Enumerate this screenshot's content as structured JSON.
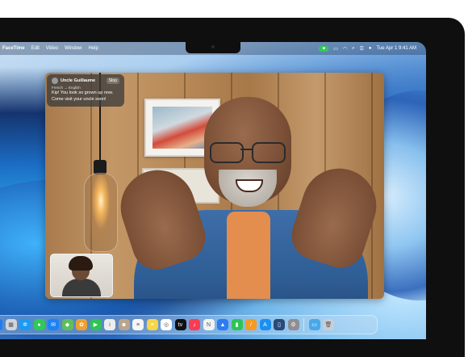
{
  "menubar": {
    "app": "FaceTime",
    "items": [
      "Edit",
      "Video",
      "Window",
      "Help"
    ],
    "clock": "Tue Apr 1  9:41 AM"
  },
  "call": {
    "caller": "Uncle Guillaume",
    "stop_label": "Stop",
    "language": "French → English",
    "message_line1": "Kip! You look so grown up now.",
    "message_line2": "Come visit your uncle soon!"
  },
  "dock": {
    "apps": [
      {
        "name": "finder-icon",
        "color": "#1e7cf0",
        "glyph": "☺"
      },
      {
        "name": "launchpad-icon",
        "color": "#d0d4db",
        "glyph": "▦"
      },
      {
        "name": "safari-icon",
        "color": "#1b9af2",
        "glyph": "✲"
      },
      {
        "name": "messages-icon",
        "color": "#30c85a",
        "glyph": "●"
      },
      {
        "name": "mail-icon",
        "color": "#1c82f5",
        "glyph": "✉"
      },
      {
        "name": "maps-icon",
        "color": "#5fbf5a",
        "glyph": "◆"
      },
      {
        "name": "photos-icon",
        "color": "#f0a030",
        "glyph": "✿"
      },
      {
        "name": "facetime-icon",
        "color": "#2ec455",
        "glyph": "▶"
      },
      {
        "name": "info-icon",
        "color": "#eeeeee",
        "glyph": "i"
      },
      {
        "name": "contacts-icon",
        "color": "#b8a58c",
        "glyph": "☻"
      },
      {
        "name": "reminders-icon",
        "color": "#f5f5f5",
        "glyph": "≡"
      },
      {
        "name": "notes-icon",
        "color": "#f7d44a",
        "glyph": "≡"
      },
      {
        "name": "freeform-icon",
        "color": "#ffffff",
        "glyph": "◎"
      },
      {
        "name": "tv-icon",
        "color": "#111111",
        "glyph": "tv"
      },
      {
        "name": "music-icon",
        "color": "#fa3c52",
        "glyph": "♪"
      },
      {
        "name": "news-icon",
        "color": "#f2f2f2",
        "glyph": "N"
      },
      {
        "name": "keynote-icon",
        "color": "#2d7cf0",
        "glyph": "▲"
      },
      {
        "name": "numbers-icon",
        "color": "#2ec455",
        "glyph": "▮"
      },
      {
        "name": "pages-icon",
        "color": "#f59a23",
        "glyph": "/"
      },
      {
        "name": "app-store-icon",
        "color": "#1c8ff2",
        "glyph": "A"
      },
      {
        "name": "iphone-mirroring-icon",
        "color": "#2a4a7a",
        "glyph": "▯"
      },
      {
        "name": "system-settings-icon",
        "color": "#8e8e93",
        "glyph": "⚙"
      },
      {
        "name": "downloads-folder-icon",
        "color": "#4aa8e8",
        "glyph": "▭"
      },
      {
        "name": "trash-icon",
        "color": "#c8ced6",
        "glyph": "🗑"
      }
    ]
  }
}
